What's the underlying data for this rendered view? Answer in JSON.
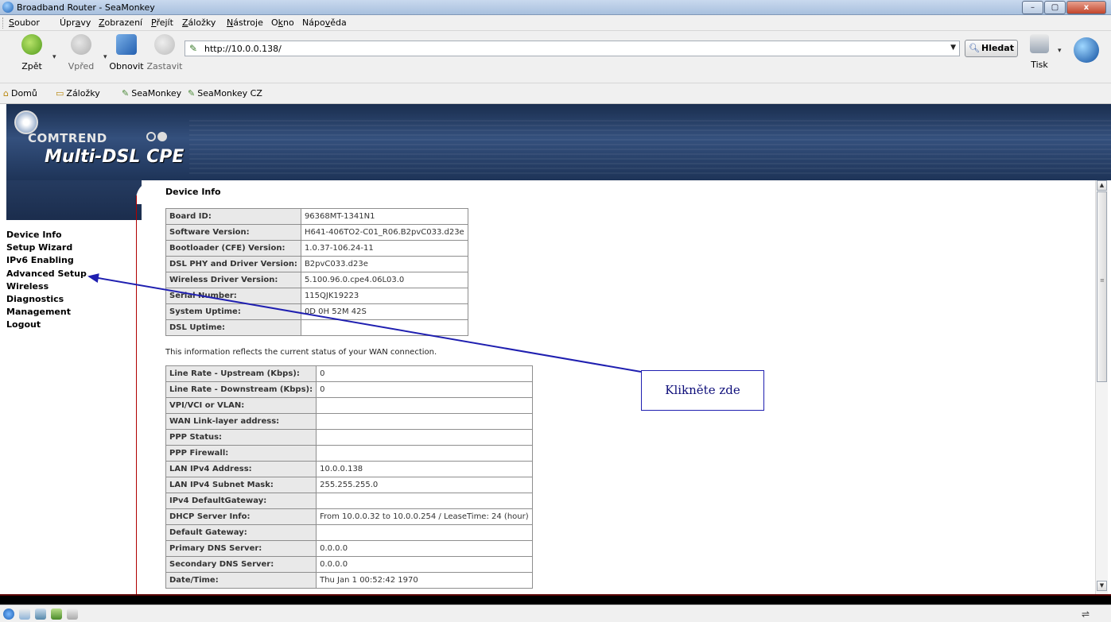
{
  "window": {
    "title": "Broadband Router - SeaMonkey",
    "controls": {
      "minimize": "–",
      "maximize": "▢",
      "close": "x"
    }
  },
  "menubar": {
    "items": [
      {
        "pre": "",
        "u": "S",
        "post": "oubor"
      },
      {
        "pre": "Úpr",
        "u": "a",
        "post": "vy"
      },
      {
        "pre": "",
        "u": "Z",
        "post": "obrazení"
      },
      {
        "pre": "",
        "u": "P",
        "post": "řejít"
      },
      {
        "pre": "",
        "u": "Z",
        "post": "áložky"
      },
      {
        "pre": "",
        "u": "N",
        "post": "ástroje"
      },
      {
        "pre": "O",
        "u": "k",
        "post": "no"
      },
      {
        "pre": "Nápo",
        "u": "v",
        "post": "ěda"
      }
    ]
  },
  "toolbar": {
    "back": "Zpět",
    "forward": "Vpřed",
    "reload": "Obnovit",
    "stop": "Zastavit",
    "url": "http://10.0.0.138/",
    "search": "Hledat",
    "print": "Tisk"
  },
  "bookmarks": {
    "items": [
      "Domů",
      "Záložky",
      "SeaMonkey",
      "SeaMonkey CZ"
    ]
  },
  "banner": {
    "brand": "COMTREND",
    "product": "Multi-DSL CPE"
  },
  "nav": {
    "items": [
      "Device Info",
      "Setup Wizard",
      "IPv6 Enabling",
      "Advanced Setup",
      "Wireless",
      "Diagnostics",
      "Management",
      "Logout"
    ]
  },
  "device": {
    "title": "Device Info",
    "rows": [
      {
        "label": "Board ID:",
        "value": "96368MT-1341N1"
      },
      {
        "label": "Software Version:",
        "value": "H641-406TO2-C01_R06.B2pvC033.d23e"
      },
      {
        "label": "Bootloader (CFE) Version:",
        "value": "1.0.37-106.24-11"
      },
      {
        "label": "DSL PHY and Driver Version:",
        "value": "B2pvC033.d23e"
      },
      {
        "label": "Wireless Driver Version:",
        "value": "5.100.96.0.cpe4.06L03.0"
      },
      {
        "label": "Serial Number:",
        "value": "115QJK19223"
      },
      {
        "label": "System Uptime:",
        "value": "0D 0H 52M 42S"
      },
      {
        "label": "DSL Uptime:",
        "value": ""
      }
    ],
    "note": "This information reflects the current status of your WAN connection."
  },
  "wan": {
    "rows": [
      {
        "label": "Line Rate - Upstream (Kbps):",
        "value": "0"
      },
      {
        "label": "Line Rate - Downstream (Kbps):",
        "value": "0"
      },
      {
        "label": "VPI/VCI or VLAN:",
        "value": ""
      },
      {
        "label": "WAN Link-layer address:",
        "value": ""
      },
      {
        "label": "PPP Status:",
        "value": ""
      },
      {
        "label": "PPP Firewall:",
        "value": ""
      },
      {
        "label": "LAN IPv4 Address:",
        "value": "10.0.0.138"
      },
      {
        "label": "LAN IPv4 Subnet Mask:",
        "value": "255.255.255.0"
      },
      {
        "label": "IPv4 DefaultGateway:",
        "value": ""
      },
      {
        "label": "DHCP Server Info:",
        "value": "From 10.0.0.32 to 10.0.0.254 / LeaseTime: 24 (hour)"
      },
      {
        "label": "Default Gateway:",
        "value": ""
      },
      {
        "label": "Primary DNS Server:",
        "value": "0.0.0.0"
      },
      {
        "label": "Secondary DNS Server:",
        "value": "0.0.0.0"
      },
      {
        "label": "Date/Time:",
        "value": "Thu Jan 1 00:52:42 1970"
      }
    ]
  },
  "annotation": {
    "text": "Klikněte zde",
    "color": "#1f1fb0"
  },
  "colors": {
    "banner": "#2a426b",
    "sidebar_line": "#b10000",
    "label_cell": "#e9e9e9"
  }
}
